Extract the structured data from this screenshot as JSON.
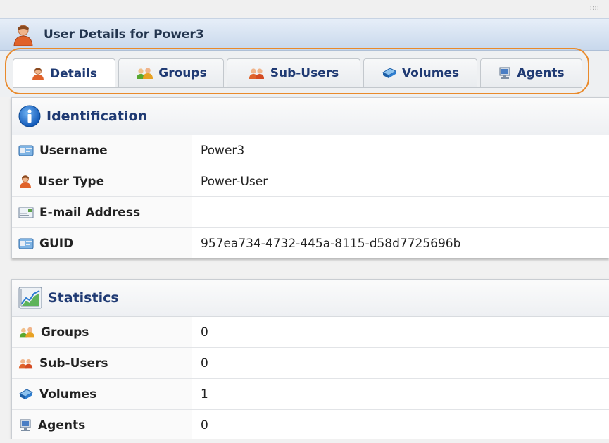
{
  "window": {
    "title": "User Details for Power3",
    "grip": "::::"
  },
  "tabs": [
    {
      "id": "details",
      "label": "Details",
      "icon": "user-icon",
      "active": true
    },
    {
      "id": "groups",
      "label": "Groups",
      "icon": "groups-icon",
      "active": false
    },
    {
      "id": "subusers",
      "label": "Sub-Users",
      "icon": "sub-users-icon",
      "active": false
    },
    {
      "id": "volumes",
      "label": "Volumes",
      "icon": "volumes-icon",
      "active": false
    },
    {
      "id": "agents",
      "label": "Agents",
      "icon": "agents-icon",
      "active": false
    }
  ],
  "identification": {
    "title": "Identification",
    "icon": "info-icon",
    "rows": [
      {
        "label": "Username",
        "icon": "id-card-icon",
        "value": "Power3"
      },
      {
        "label": "User Type",
        "icon": "user-icon",
        "value": "Power-User"
      },
      {
        "label": "E-mail Address",
        "icon": "email-icon",
        "value": ""
      },
      {
        "label": "GUID",
        "icon": "id-card-icon",
        "value": "957ea734-4732-445a-8115-d58d7725696b"
      }
    ]
  },
  "statistics": {
    "title": "Statistics",
    "icon": "chart-icon",
    "rows": [
      {
        "label": "Groups",
        "icon": "groups-icon",
        "value": "0"
      },
      {
        "label": "Sub-Users",
        "icon": "sub-users-icon",
        "value": "0"
      },
      {
        "label": "Volumes",
        "icon": "volumes-icon",
        "value": "1"
      },
      {
        "label": "Agents",
        "icon": "agents-icon",
        "value": "0"
      }
    ]
  },
  "colors": {
    "accent_highlight": "#e98a2b",
    "label_text": "#1f3a73",
    "title_text": "#23354e"
  }
}
